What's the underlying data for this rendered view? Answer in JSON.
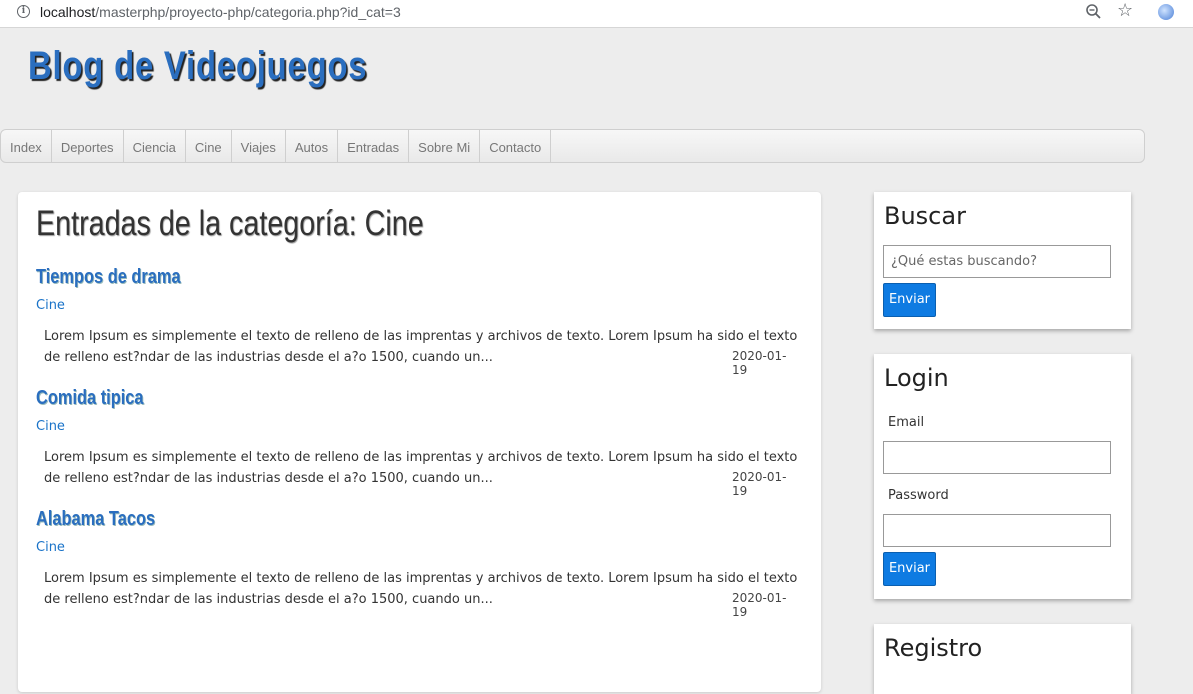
{
  "browser": {
    "url_host": "localhost",
    "url_path": "/masterphp/proyecto-php/categoria.php?id_cat=3",
    "icons": [
      "info-icon",
      "zoom-icon",
      "star-icon",
      "extension-icon"
    ]
  },
  "site": {
    "title": "Blog de Videojuegos"
  },
  "nav": {
    "items": [
      "Index",
      "Deportes",
      "Ciencia",
      "Cine",
      "Viajes",
      "Autos",
      "Entradas",
      "Sobre Mi",
      "Contacto"
    ]
  },
  "main": {
    "heading": "Entradas de la categoría: Cine",
    "entries": [
      {
        "title": "Tiempos de drama",
        "category": "Cine",
        "description": "Lorem Ipsum es simplemente el texto de relleno de las imprentas y archivos de texto. Lorem Ipsum ha sido el texto de relleno est?ndar de las industrias desde el a?o 1500, cuando un...",
        "date": "2020-01-19"
      },
      {
        "title": "Comida tipica",
        "category": "Cine",
        "description": "Lorem Ipsum es simplemente el texto de relleno de las imprentas y archivos de texto. Lorem Ipsum ha sido el texto de relleno est?ndar de las industrias desde el a?o 1500, cuando un...",
        "date": "2020-01-19"
      },
      {
        "title": "Alabama Tacos",
        "category": "Cine",
        "description": "Lorem Ipsum es simplemente el texto de relleno de las imprentas y archivos de texto. Lorem Ipsum ha sido el texto de relleno est?ndar de las industrias desde el a?o 1500, cuando un...",
        "date": "2020-01-19"
      }
    ]
  },
  "sidebar": {
    "search": {
      "title": "Buscar",
      "placeholder": "¿Qué estas buscando?",
      "button": "Enviar"
    },
    "login": {
      "title": "Login",
      "email_label": "Email",
      "password_label": "Password",
      "button": "Enviar"
    },
    "register": {
      "title": "Registro"
    }
  },
  "colors": {
    "accent": "#2a6ebf",
    "button": "#0e7be2",
    "background": "#ededed"
  }
}
